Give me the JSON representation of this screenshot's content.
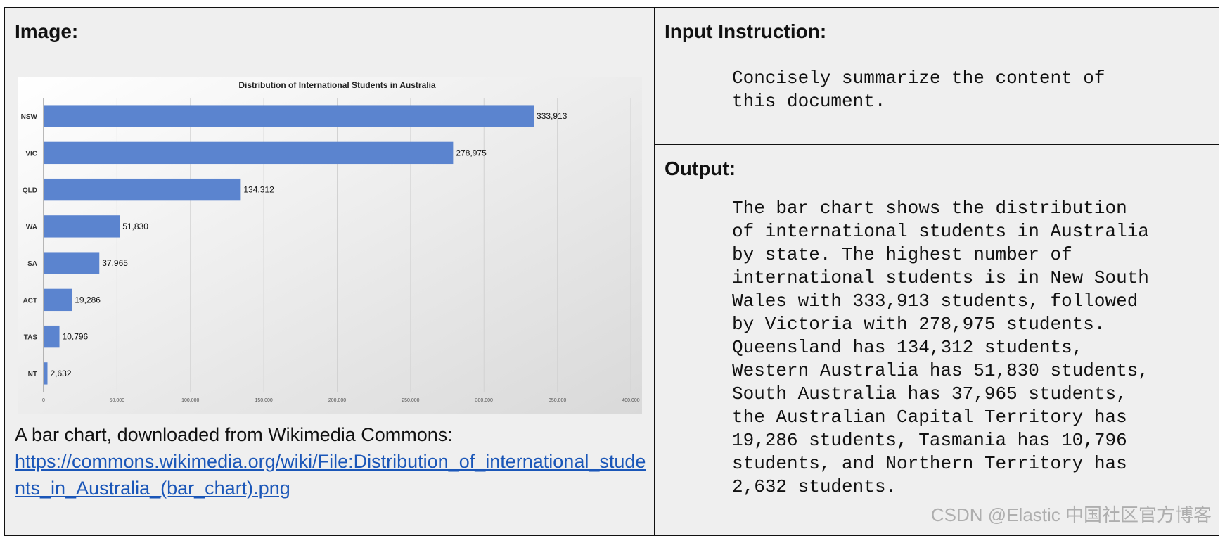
{
  "left_panel": {
    "heading": "Image:",
    "caption_text": "A bar chart, downloaded from Wikimedia Commons:",
    "caption_link": "https://commons.wikimedia.org/wiki/File:Distribution_of_international_students_in_Australia_(bar_chart).png"
  },
  "instruction_panel": {
    "heading": "Input Instruction:",
    "text": "Concisely summarize the content of\nthis document."
  },
  "output_panel": {
    "heading": "Output:",
    "text": "The bar chart shows the distribution\nof international students in Australia\nby state. The highest number of\ninternational students is in New South\nWales with 333,913 students, followed\nby Victoria with 278,975 students.\nQueensland has 134,312 students,\nWestern Australia has 51,830 students,\nSouth Australia has 37,965 students,\nthe Australian Capital Territory has\n19,286 students, Tasmania has 10,796\nstudents, and Northern Territory has\n2,632 students."
  },
  "watermark": "CSDN @Elastic 中国社区官方博客",
  "colors": {
    "bar": "#5b84cf",
    "link": "#1a56b8",
    "panel_bg": "#efefef"
  },
  "chart_data": {
    "type": "bar",
    "orientation": "horizontal",
    "title": "Distribution of International Students in Australia",
    "categories": [
      "NSW",
      "VIC",
      "QLD",
      "WA",
      "SA",
      "ACT",
      "TAS",
      "NT"
    ],
    "values": [
      333913,
      278975,
      134312,
      51830,
      37965,
      19286,
      10796,
      2632
    ],
    "value_labels": [
      "333,913",
      "278,975",
      "134,312",
      "51,830",
      "37,965",
      "19,286",
      "10,796",
      "2,632"
    ],
    "xlim": [
      0,
      400000
    ],
    "xticks": [
      0,
      50000,
      100000,
      150000,
      200000,
      250000,
      300000,
      350000,
      400000
    ],
    "xtick_labels": [
      "0",
      "50,000",
      "100,000",
      "150,000",
      "200,000",
      "250,000",
      "300,000",
      "350,000",
      "400,000"
    ],
    "grid": true,
    "xlabel": "",
    "ylabel": ""
  }
}
